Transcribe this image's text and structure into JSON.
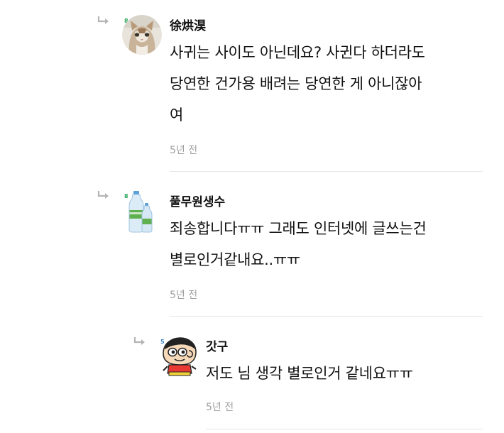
{
  "comments": [
    {
      "nickname": "徐烘淏",
      "level": "8",
      "text": "사귀는 사이도 아닌데요? 사귄다 하더라도\n당연한 건가용 배려는 당연한 게 아니잖아\n여",
      "time": "5년 전",
      "avatar": "cat-avatar"
    },
    {
      "nickname": "풀무원생수",
      "level": "8",
      "text": "죄송합니다ㅠㅠ 그래도 인터넷에 글쓰는건\n별로인거같내요..ㅠㅠ",
      "time": "5년 전",
      "avatar": "water-bottle-avatar"
    },
    {
      "nickname": "갓구",
      "level": "5",
      "text": "저도 님 생각 별로인거 같네요ㅠㅠ",
      "time": "5년 전",
      "avatar": "cartoon-boy-avatar"
    }
  ],
  "colors": {
    "level_badge_green": "#2aa55a",
    "level_badge_blue": "#3b82c8",
    "timestamp": "#a0a0a0",
    "divider": "#e6e6e6",
    "reply_arrow": "#b5b5b5"
  }
}
